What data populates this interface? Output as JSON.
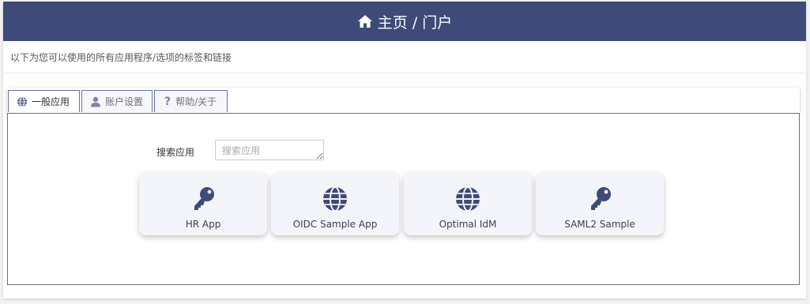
{
  "header": {
    "title": "主页 / 门户",
    "icon": "home-icon"
  },
  "subtitle": "以下为您可以使用的所有应用程序/选项的标签和链接",
  "tabs": [
    {
      "label": "一般应用",
      "icon": "globe-icon",
      "active": true
    },
    {
      "label": "账户设置",
      "icon": "user-icon",
      "active": false
    },
    {
      "label": "帮助/关于",
      "icon": "question-icon",
      "active": false
    }
  ],
  "search": {
    "label": "搜索应用",
    "placeholder": "搜索应用",
    "value": ""
  },
  "apps": [
    {
      "label": "HR App",
      "icon": "key-icon"
    },
    {
      "label": "OIDC Sample App",
      "icon": "globe-icon"
    },
    {
      "label": "Optimal IdM",
      "icon": "globe-icon"
    },
    {
      "label": "SAML2 Sample",
      "icon": "key-icon"
    }
  ],
  "colors": {
    "header_bg": "#3e4a78",
    "icon_color": "#3e4a78",
    "card_bg": "#f4f5fb"
  }
}
